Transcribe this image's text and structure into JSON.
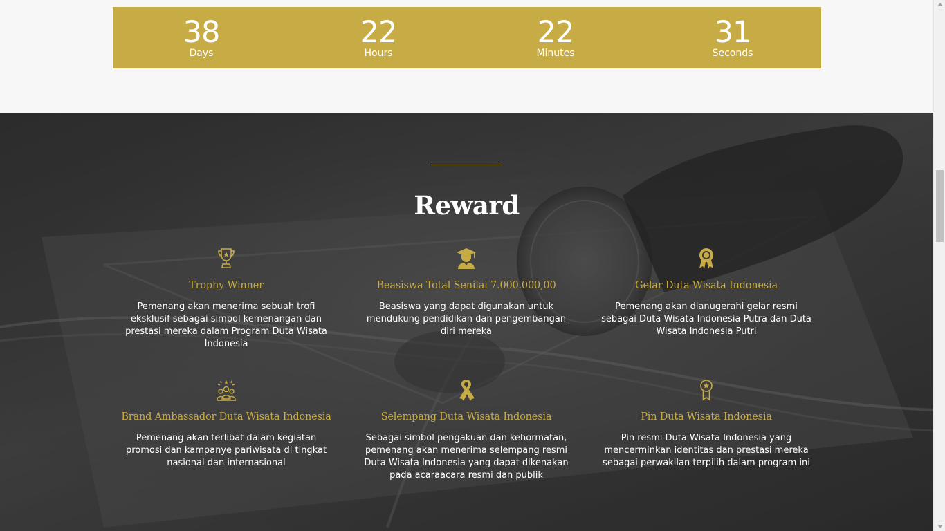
{
  "countdown": [
    {
      "value": "38",
      "label": "Days"
    },
    {
      "value": "22",
      "label": "Hours"
    },
    {
      "value": "22",
      "label": "Minutes"
    },
    {
      "value": "31",
      "label": "Seconds"
    }
  ],
  "reward": {
    "title": "Reward",
    "items": [
      {
        "icon": "trophy-icon",
        "title": "Trophy Winner",
        "text": "Pemenang akan menerima sebuah trofi eksklusif sebagai simbol kemenangan dan prestasi mereka dalam Program Duta Wisata Indonesia"
      },
      {
        "icon": "graduate-icon",
        "title": "Beasiswa Total Senilai 7.000.000,00",
        "text": "Beasiswa yang dapat digunakan untuk mendukung pendidikan dan pengembangan diri mereka"
      },
      {
        "icon": "award-rosette-icon",
        "title": "Gelar Duta Wisata Indonesia",
        "text": "Pemenang akan dianugerahi gelar resmi sebagai Duta Wisata Indonesia Putra dan Duta Wisata Indonesia Putri"
      },
      {
        "icon": "group-star-icon",
        "title": "Brand Ambassador Duta Wisata Indonesia",
        "text": "Pemenang akan terlibat dalam kegiatan promosi dan kampanye pariwisata di tingkat nasional dan internasional"
      },
      {
        "icon": "ribbon-icon",
        "title": "Selempang Duta Wisata Indonesia",
        "text": "Sebagai simbol pengakuan dan kehormatan, pemenang akan menerima selempang resmi Duta Wisata Indonesia yang dapat dikenakan pada acaraacara resmi dan publik"
      },
      {
        "icon": "pin-medal-icon",
        "title": "Pin Duta Wisata Indonesia",
        "text": "Pin resmi Duta Wisata Indonesia yang mencerminkan identitas dan prestasi mereka sebagai perwakilan terpilih dalam program ini"
      }
    ]
  },
  "colors": {
    "gold": "#c7ac45",
    "dark": "#3e3e3e",
    "light": "#f7f7f7"
  }
}
